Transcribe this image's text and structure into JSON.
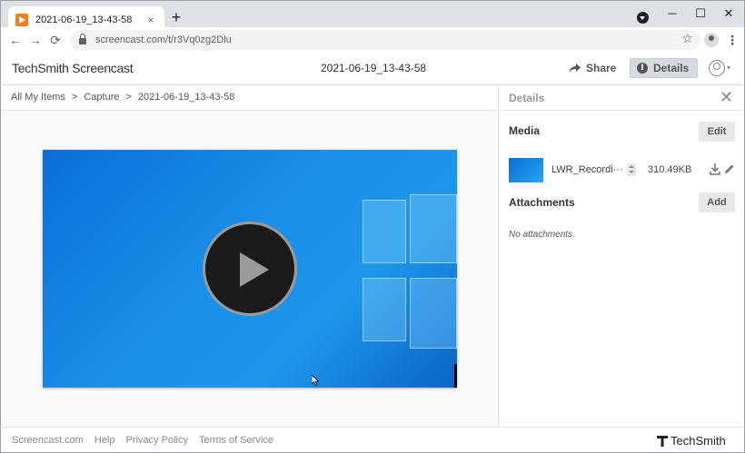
{
  "browser": {
    "tab_title": "2021-06-19_13-43-58",
    "tab_close": "×",
    "new_tab": "+",
    "url": "screencast.com/t/r3Vq0zg2Dlu",
    "window_controls": {
      "minimize": "─",
      "maximize": "☐",
      "close": "✕"
    },
    "nav": {
      "back": "←",
      "forward": "→",
      "reload": "⟳"
    },
    "bookmark": "☆",
    "menu": "⋮"
  },
  "app": {
    "logo": "TechSmith Screencast",
    "title": "2021-06-19_13-43-58",
    "share_label": "Share",
    "details_label": "Details",
    "user_caret": "▾"
  },
  "breadcrumb": {
    "items": [
      "All My Items",
      "Capture",
      "2021-06-19_13-43-58"
    ],
    "separator": ">"
  },
  "video": {
    "accent": "#1a8fe8"
  },
  "details": {
    "title": "Details",
    "close": "✕",
    "media_label": "Media",
    "edit_label": "Edit",
    "file_name": "LWR_Recordi···",
    "file_size": "310.49KB",
    "attachments_label": "Attachments",
    "add_label": "Add",
    "no_attachments": "No attachments."
  },
  "footer": {
    "links": [
      "Screencast.com",
      "Help",
      "Privacy Policy",
      "Terms of Service"
    ],
    "brand": "TechSmith"
  }
}
